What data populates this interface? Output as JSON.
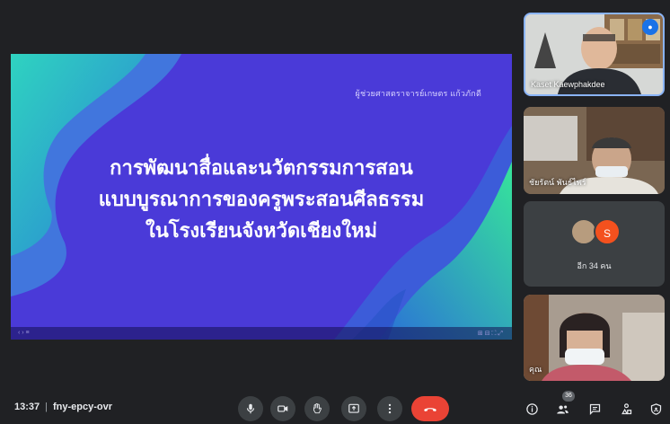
{
  "slide": {
    "presenter_line": "ผู้ช่วยศาสตราจารย์เกษตร แก้วภักดี",
    "title_line1": "การพัฒนาสื่อและนวัตกรรมการสอน",
    "title_line2": "แบบบูรณาการของครูพระสอนศีลธรรม",
    "title_line3": "ในโรงเรียนจังหวัดเชียงใหม่",
    "nav_left": "‹ ›  ≡",
    "nav_right": "⊞ ⊟ ⛶ ⤢"
  },
  "participants": {
    "tile1_name": "Kaset Kaewphakdee",
    "tile2_name": "ชัยรัตน์ พันธ์ไพร์",
    "others_avatar_letter": "S",
    "others_label": "อีก 34 คน",
    "self_label": "คุณ"
  },
  "meeting": {
    "time": "13:37",
    "separator": "|",
    "code": "fny-epcy-ovr",
    "people_count": "36"
  },
  "colors": {
    "slide_bg": "#4a3ad8",
    "accent_green": "#3ee29a",
    "end_call": "#ea4335",
    "toolbar_bg": "#202124"
  },
  "icons": [
    "mic-icon",
    "camera-icon",
    "hand-icon",
    "present-icon",
    "more-icon",
    "end-call-icon",
    "info-icon",
    "people-icon",
    "chat-icon",
    "activities-icon",
    "security-icon"
  ]
}
